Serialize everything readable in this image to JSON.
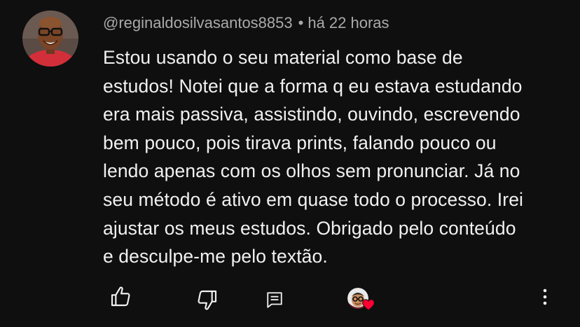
{
  "comment": {
    "author": "@reginaldosilvasantos8853",
    "separator": "•",
    "timestamp": "há 22 horas",
    "text_lines": [
      "Estou usando o seu material como base de",
      "estudos! Notei que a forma q eu estava estudando",
      "era mais passiva, assistindo, ouvindo, escrevendo",
      "bem pouco, pois tirava prints, falando pouco ou",
      "lendo apenas com os olhos sem pronunciar. Já no",
      "seu método é ativo em quase todo o processo. Irei",
      "ajustar os meus estudos. Obrigado pelo conteúdo",
      "e desculpe-me pelo textão."
    ]
  },
  "actions": {
    "like_icon": "thumb-up-icon",
    "dislike_icon": "thumb-down-icon",
    "reply_icon": "comment-icon",
    "creator_heart_icon": "creator-heart-icon",
    "more_icon": "more-vertical-icon"
  },
  "colors": {
    "background": "#0f0f0f",
    "text": "#f1f1f1",
    "secondary_text": "#aaaaaa",
    "heart": "#ff0033",
    "avatar_shirt": "#d32f3a"
  }
}
